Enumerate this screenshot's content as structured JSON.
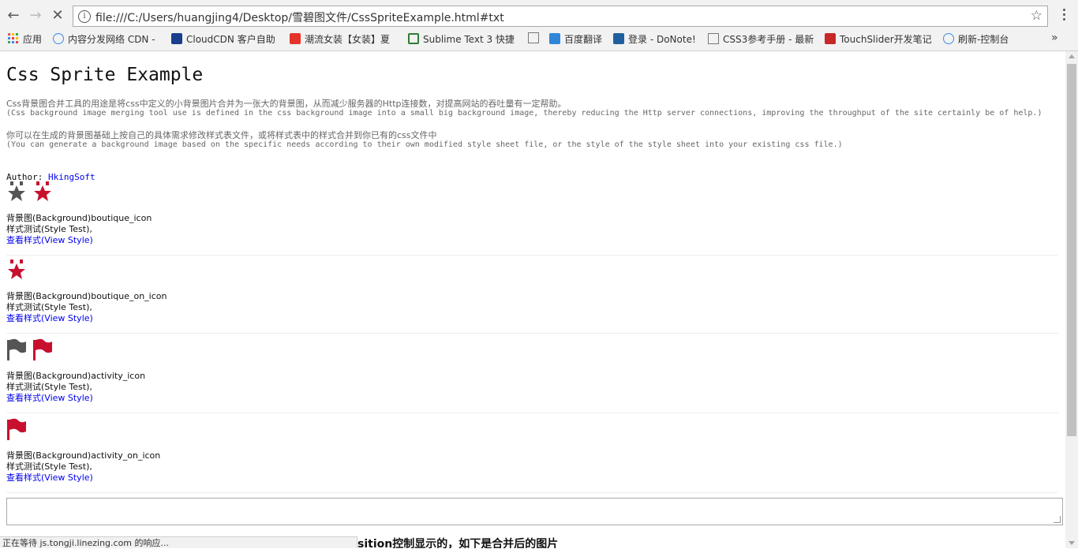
{
  "browser": {
    "url": "file:///C:/Users/huangjing4/Desktop/雪碧图文件/CssSpriteExample.html#txt",
    "bookmarks": [
      {
        "label": "应用",
        "color": "#e94235"
      },
      {
        "label": "内容分发网络 CDN -",
        "color": "#3b8de0"
      },
      {
        "label": "CloudCDN 客户自助",
        "color": "#1a3e8c"
      },
      {
        "label": "潮流女装【女装】夏",
        "color": "#e5332a"
      },
      {
        "label": "Sublime Text 3 快捷",
        "color": "#2e7d32"
      },
      {
        "label": "百度翻译",
        "color": "#2f86d8"
      },
      {
        "label": "登录 - DoNote!",
        "color": "#1f5f9f"
      },
      {
        "label": "CSS3参考手册 - 最新",
        "color": "#888888"
      },
      {
        "label": "TouchSlider开发笔记",
        "color": "#c62828"
      },
      {
        "label": "刷新-控制台",
        "color": "#3b8de0"
      }
    ],
    "more_bookmarks": "»",
    "status_text": "正在等待 js.tongji.linezing.com 的响应..."
  },
  "page": {
    "title": "Css Sprite Example",
    "desc1_zh": "Css背景图合并工具的用途是将css中定义的小背景图片合并为一张大的背景图，从而减少服务器的Http连接数，对提高网站的吞吐量有一定帮助。",
    "desc1_en": "(Css background image merging tool use is defined in the css background image into a small big background image, thereby reducing the Http server connections, improving the throughput of the site certainly be of help.)",
    "desc2_zh": "你可以在生成的背景图基础上按自己的具体需求修改样式表文件，或将样式表中的样式合并到你已有的css文件中",
    "desc2_en": "(You can generate a background image based on the specific needs according to their own modified style sheet file, or the style of the style sheet into your existing css file.)",
    "author_label": "Author: ",
    "author_name": "HkingSoft",
    "items": [
      {
        "bg": "背景图(Background)boutique_icon",
        "style_test": "样式测试(Style Test),",
        "view_style": "查看样式(View Style)"
      },
      {
        "bg": "背景图(Background)boutique_on_icon",
        "style_test": "样式测试(Style Test),",
        "view_style": "查看样式(View Style)"
      },
      {
        "bg": "背景图(Background)activity_icon",
        "style_test": "样式测试(Style Test),",
        "view_style": "查看样式(View Style)"
      },
      {
        "bg": "背景图(Background)activity_on_icon",
        "style_test": "样式测试(Style Test),",
        "view_style": "查看样式(View Style)"
      }
    ],
    "cut_off_text": "sition控制显示的，如下是合并后的图片"
  },
  "colors": {
    "icon_gray": "#555555",
    "icon_red": "#c8102e",
    "link": "#0000ee"
  }
}
